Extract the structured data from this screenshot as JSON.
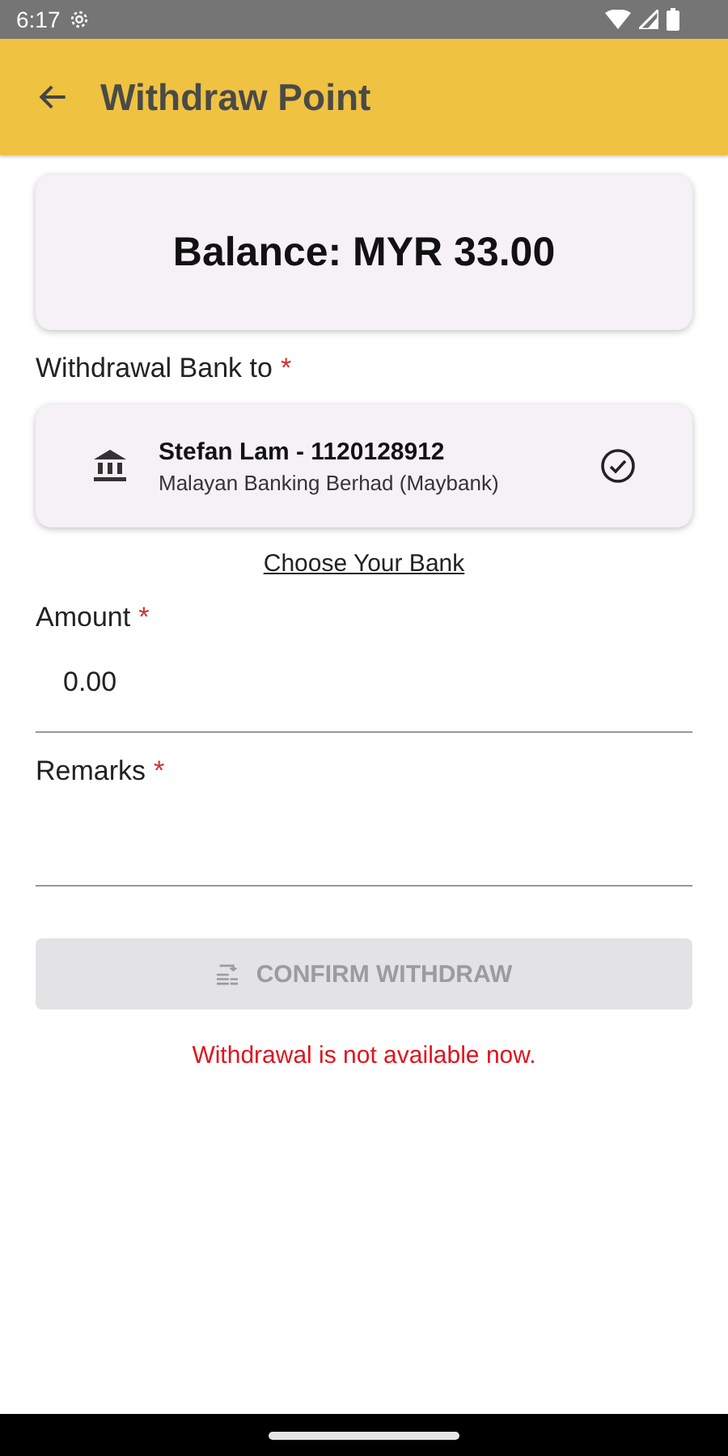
{
  "status_bar": {
    "time": "6:17"
  },
  "app_bar": {
    "title": "Withdraw Point"
  },
  "balance": {
    "text": "Balance: MYR 33.00"
  },
  "bank_section": {
    "label": "Withdrawal Bank to",
    "required_mark": "*"
  },
  "bank": {
    "name": "Stefan Lam - 1120128912",
    "bank_name": "Malayan Banking Berhad (Maybank)",
    "selected": true
  },
  "choose_bank_link": "Choose Your Bank",
  "fields": [
    {
      "label": "Amount",
      "required_mark": "*",
      "value": "0.00"
    },
    {
      "label": "Remarks",
      "required_mark": "*"
    }
  ],
  "confirm_button": {
    "label": "CONFIRM WITHDRAW",
    "disabled": true
  },
  "error_message": "Withdrawal is not available now."
}
